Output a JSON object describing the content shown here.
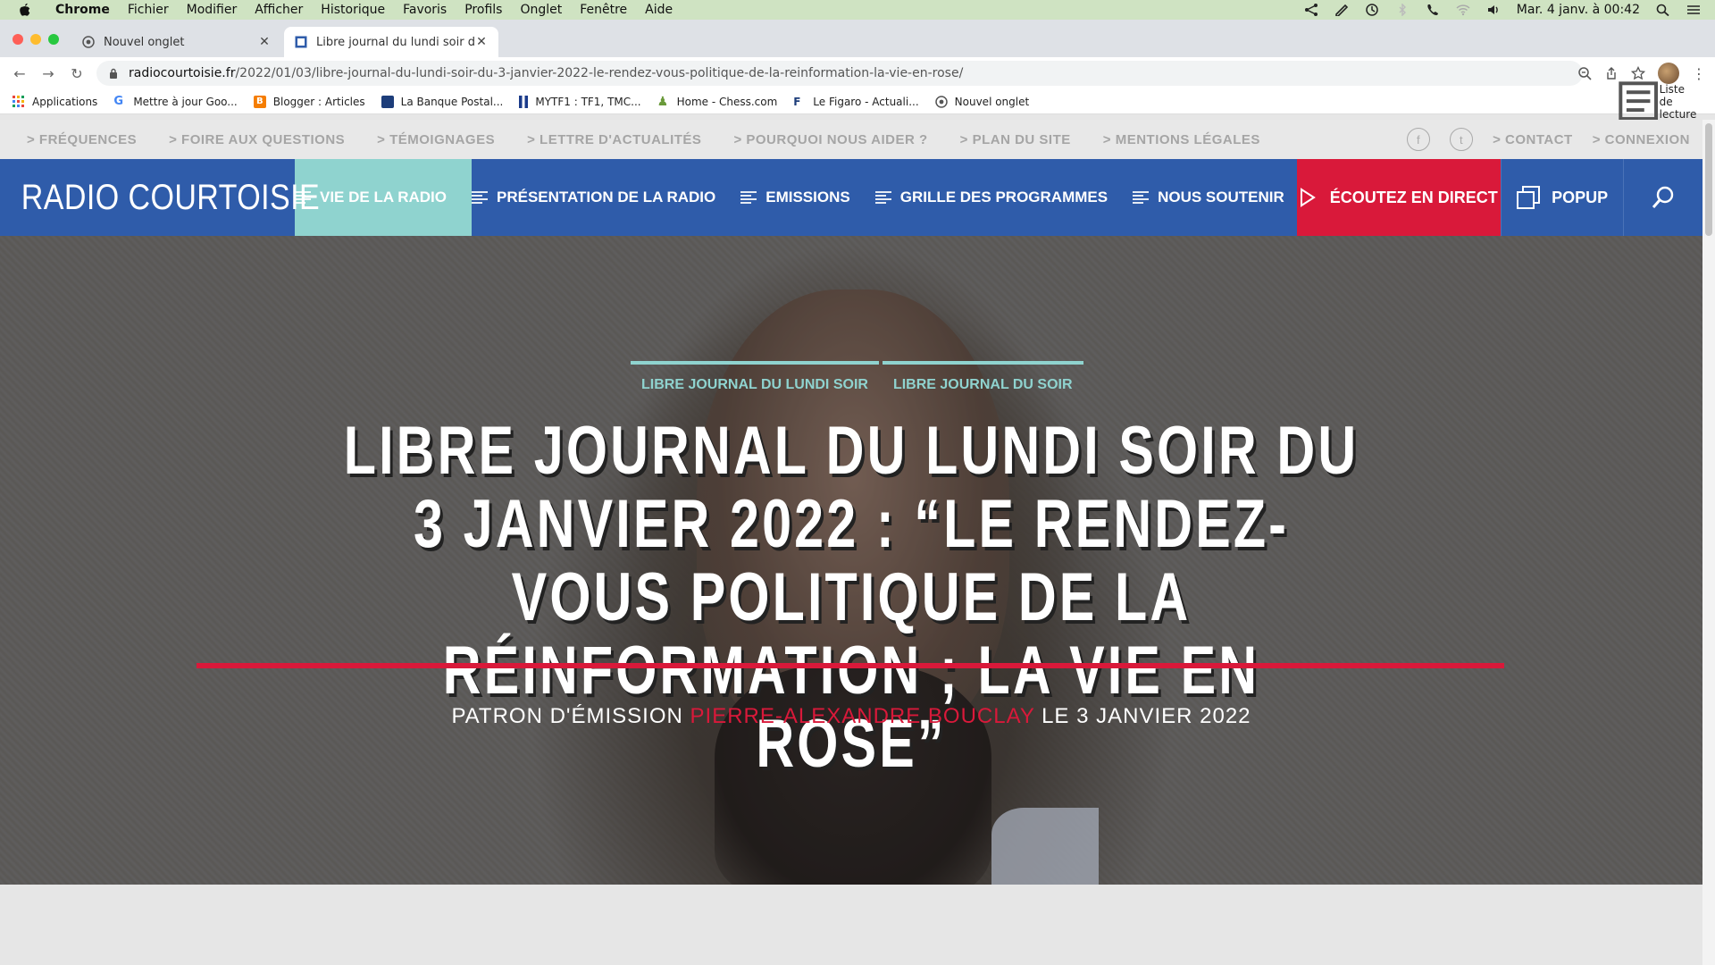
{
  "menubar": {
    "app": "Chrome",
    "items": [
      "Fichier",
      "Modifier",
      "Afficher",
      "Historique",
      "Favoris",
      "Profils",
      "Onglet",
      "Fenêtre",
      "Aide"
    ],
    "clock": "Mar. 4 janv. à 00:42"
  },
  "tabs": [
    {
      "title": "Nouvel onglet"
    },
    {
      "title": "Libre journal du lundi soir du 3"
    }
  ],
  "toolbar": {
    "url_host": "radiocourtoisie.fr",
    "url_path": "/2022/01/03/libre-journal-du-lundi-soir-du-3-janvier-2022-le-rendez-vous-politique-de-la-reinformation-la-vie-en-rose/"
  },
  "bookmarks": {
    "items": [
      "Applications",
      "Mettre à jour Goo...",
      "Blogger : Articles",
      "La Banque Postal...",
      "MYTF1 : TF1, TMC...",
      "Home - Chess.com",
      "Le Figaro - Actuali...",
      "Nouvel onglet"
    ],
    "reading_list": "Liste de lecture"
  },
  "site": {
    "top_links": [
      "> FRÉQUENCES",
      "> FOIRE AUX QUESTIONS",
      "> TÉMOIGNAGES",
      "> LETTRE D'ACTUALITÉS",
      "> POURQUOI NOUS AIDER ?",
      "> PLAN DU SITE",
      "> MENTIONS LÉGALES"
    ],
    "contact": "> CONTACT",
    "login": "> CONNEXION",
    "logo": "RADIO COURTOISIE",
    "nav": [
      "VIE DE LA RADIO",
      "PRÉSENTATION DE LA RADIO",
      "EMISSIONS",
      "GRILLE DES PROGRAMMES",
      "NOUS SOUTENIR"
    ],
    "cta": "ÉCOUTEZ EN DIRECT",
    "popup": "POPUP"
  },
  "article": {
    "categories": [
      "LIBRE JOURNAL DU LUNDI SOIR",
      "LIBRE JOURNAL DU SOIR"
    ],
    "headline": "LIBRE JOURNAL DU LUNDI SOIR DU 3 JANVIER 2022 : “LE RENDEZ-VOUS POLITIQUE DE LA RÉINFORMATION ; LA VIE EN ROSE”",
    "byline_prefix": "PATRON D'ÉMISSION",
    "author": "PIERRE-ALEXANDRE BOUCLAY",
    "date": "LE 3 JANVIER 2022"
  },
  "colors": {
    "brand_blue": "#2f5caa",
    "accent_teal": "#8fd3cf",
    "accent_red": "#d9193a"
  }
}
